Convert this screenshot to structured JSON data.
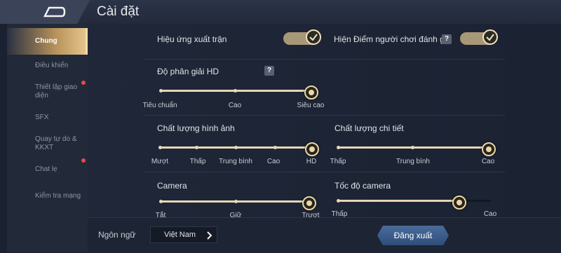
{
  "header": {
    "title": "Cài đặt"
  },
  "sidebar": {
    "items": [
      {
        "label": "Chung",
        "active": true,
        "badge": false
      },
      {
        "label": "Điều khiển",
        "active": false,
        "badge": false
      },
      {
        "label": "Thiết lập giao diện",
        "active": false,
        "badge": true
      },
      {
        "label": "SFX",
        "active": false,
        "badge": false
      },
      {
        "label": "Quay tự do & KKXT",
        "active": false,
        "badge": false
      },
      {
        "label": "Chat lẹ",
        "active": false,
        "badge": true
      },
      {
        "label": "Kiểm tra mạng",
        "active": false,
        "badge": false
      }
    ]
  },
  "toggles": {
    "battle_effect": {
      "label": "Hiệu ứng xuất trận",
      "on": true
    },
    "show_rating": {
      "label": "Hiện Điểm người chơi đánh giá",
      "help": "?",
      "on": true
    }
  },
  "sliders": {
    "resolution": {
      "label": "Độ phân giải HD",
      "help": "?",
      "ticks": [
        "Tiêu chuẩn",
        "Cao",
        "Siêu cao"
      ],
      "value": "Siêu cao"
    },
    "image_quality": {
      "label": "Chất lượng hình ảnh",
      "ticks": [
        "Mượt",
        "Thấp",
        "Trung bình",
        "Cao",
        "HD"
      ],
      "value": "HD"
    },
    "detail_quality": {
      "label": "Chất lượng chi tiết",
      "ticks": [
        "Thấp",
        "Trung bình",
        "Cao"
      ],
      "value": "Cao"
    },
    "camera": {
      "label": "Camera",
      "ticks": [
        "Tắt",
        "Giữ",
        "Trượt"
      ],
      "value": "Trượt"
    },
    "camera_speed": {
      "label": "Tốc độ camera",
      "ticks": [
        "Thấp",
        "Cao"
      ],
      "value_fraction": 0.78
    }
  },
  "footer": {
    "language_label": "Ngôn ngữ",
    "language_value": "Việt Nam",
    "logout_label": "Đăng xuất"
  },
  "colors": {
    "accent_gold": "#e9d7ac",
    "badge_red": "#e8474c",
    "logout_blue": "#3a5a8a"
  }
}
